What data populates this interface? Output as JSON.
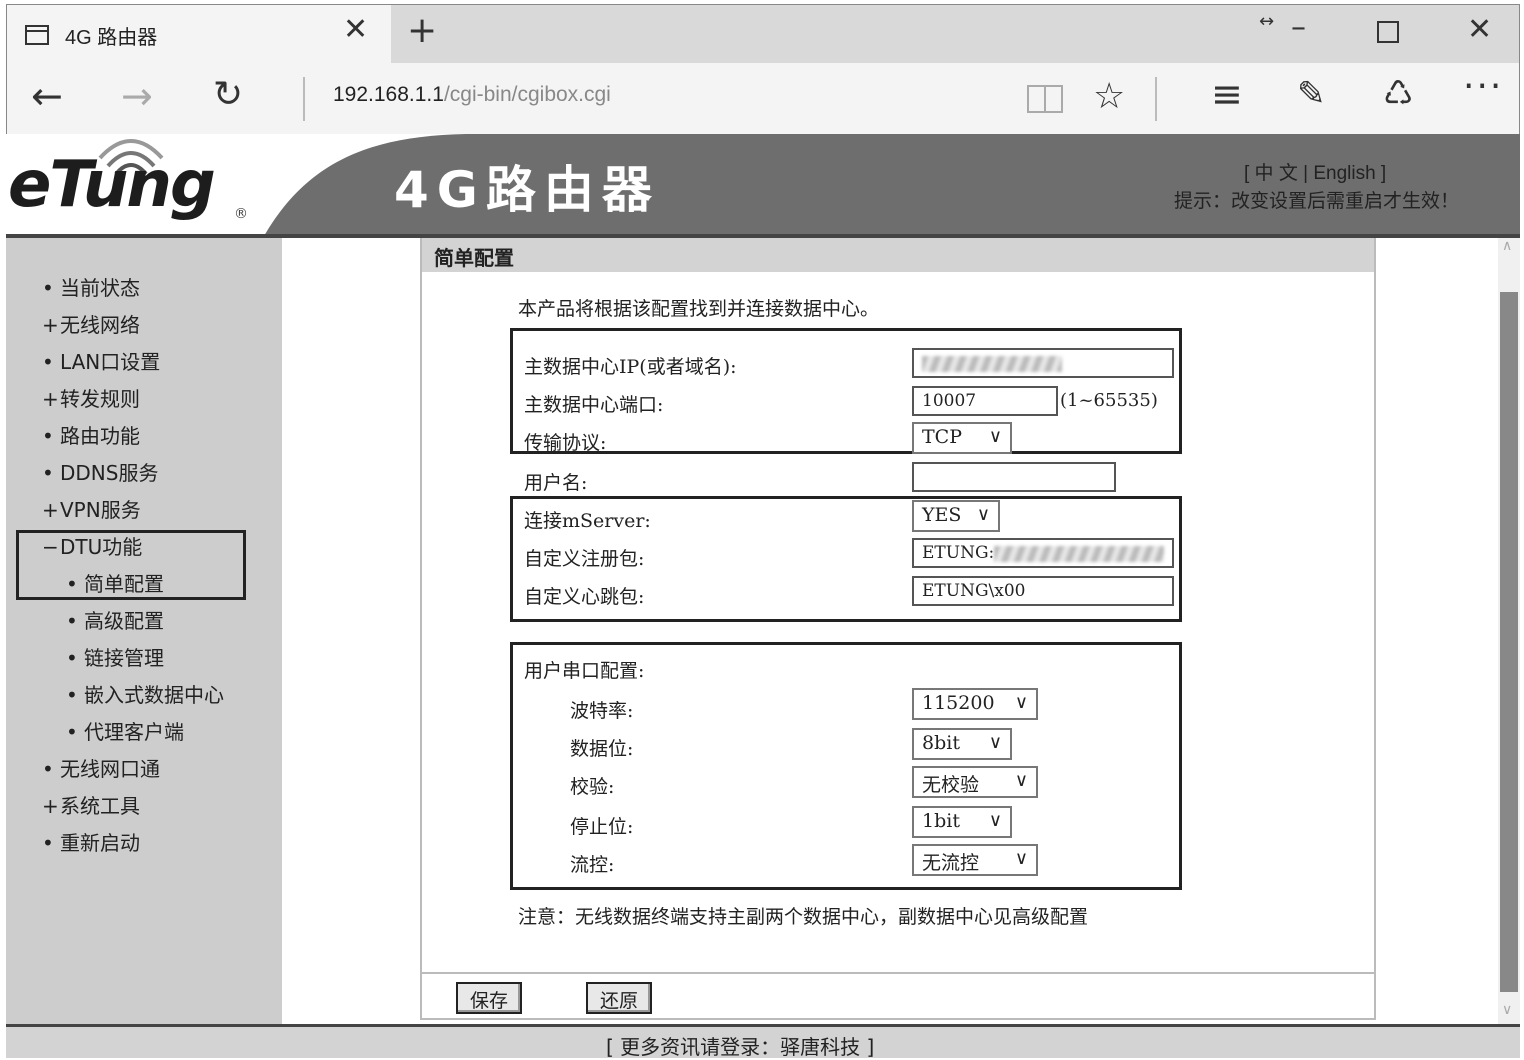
{
  "browser": {
    "tab_title": "4G 路由器",
    "close_tab_glyph": "✕",
    "new_tab_glyph": "+",
    "address_host": "192.168.1.1",
    "address_path": "/cgi-bin/cgibox.cgi",
    "icons": [
      "page-icon",
      "back-icon",
      "forward-icon",
      "refresh-icon",
      "reading-view-icon",
      "favorite-star-icon",
      "hub-icon",
      "web-note-icon",
      "share-icon",
      "more-icon",
      "minimize-icon",
      "maximize-icon",
      "close-icon"
    ]
  },
  "header": {
    "logo_text": "eTung",
    "logo_mark": "®",
    "title": "4G路由器",
    "lang_switch": "[ 中 文 | English ]",
    "restart_hint": "提示：改变设置后需重启才生效！",
    "band_color": "#6e6e6e"
  },
  "sidebar": {
    "items": [
      {
        "bullet": "•",
        "label": "当前状态"
      },
      {
        "bullet": "+",
        "label": "无线网络"
      },
      {
        "bullet": "•",
        "label": "LAN口设置"
      },
      {
        "bullet": "+",
        "label": "转发规则"
      },
      {
        "bullet": "•",
        "label": "路由功能"
      },
      {
        "bullet": "•",
        "label": "DDNS服务"
      },
      {
        "bullet": "+",
        "label": "VPN服务"
      },
      {
        "bullet": "−",
        "label": "DTU功能"
      },
      {
        "bullet": "•",
        "label": "简单配置"
      },
      {
        "bullet": "•",
        "label": "高级配置"
      },
      {
        "bullet": "•",
        "label": "链接管理"
      },
      {
        "bullet": "•",
        "label": "嵌入式数据中心"
      },
      {
        "bullet": "•",
        "label": "代理客户端"
      },
      {
        "bullet": "•",
        "label": "无线网口通"
      },
      {
        "bullet": "+",
        "label": "系统工具"
      },
      {
        "bullet": "•",
        "label": "重新启动"
      }
    ]
  },
  "main": {
    "panel_title": "简单配置",
    "intro": "本产品将根据该配置找到并连接数据中心。",
    "fields": {
      "server_ip_label": "主数据中心IP(或者域名):",
      "server_ip_value": "",
      "server_port_label": "主数据中心端口:",
      "server_port_value": "10007",
      "server_port_range": "(1~65535)",
      "protocol_label": "传输协议:",
      "protocol_value": "TCP",
      "username_label": "用户名:",
      "username_value": "",
      "mserver_label": "连接mServer:",
      "mserver_value": "YES",
      "register_label": "自定义注册包:",
      "register_value": "ETUNG:",
      "heartbeat_label": "自定义心跳包:",
      "heartbeat_value": "ETUNG\\x00"
    },
    "serial": {
      "group_label": "用户串口配置:",
      "baud_label": "波特率:",
      "baud_value": "115200",
      "databits_label": "数据位:",
      "databits_value": "8bit",
      "parity_label": "校验:",
      "parity_value": "无校验",
      "stopbits_label": "停止位:",
      "stopbits_value": "1bit",
      "flow_label": "流控:",
      "flow_value": "无流控"
    },
    "note": "注意：无线数据终端支持主副两个数据中心，副数据中心见高级配置",
    "buttons": {
      "save": "保存",
      "restore": "还原"
    }
  },
  "footer": {
    "text": "[ 更多资讯请登录：驿唐科技 ]"
  }
}
